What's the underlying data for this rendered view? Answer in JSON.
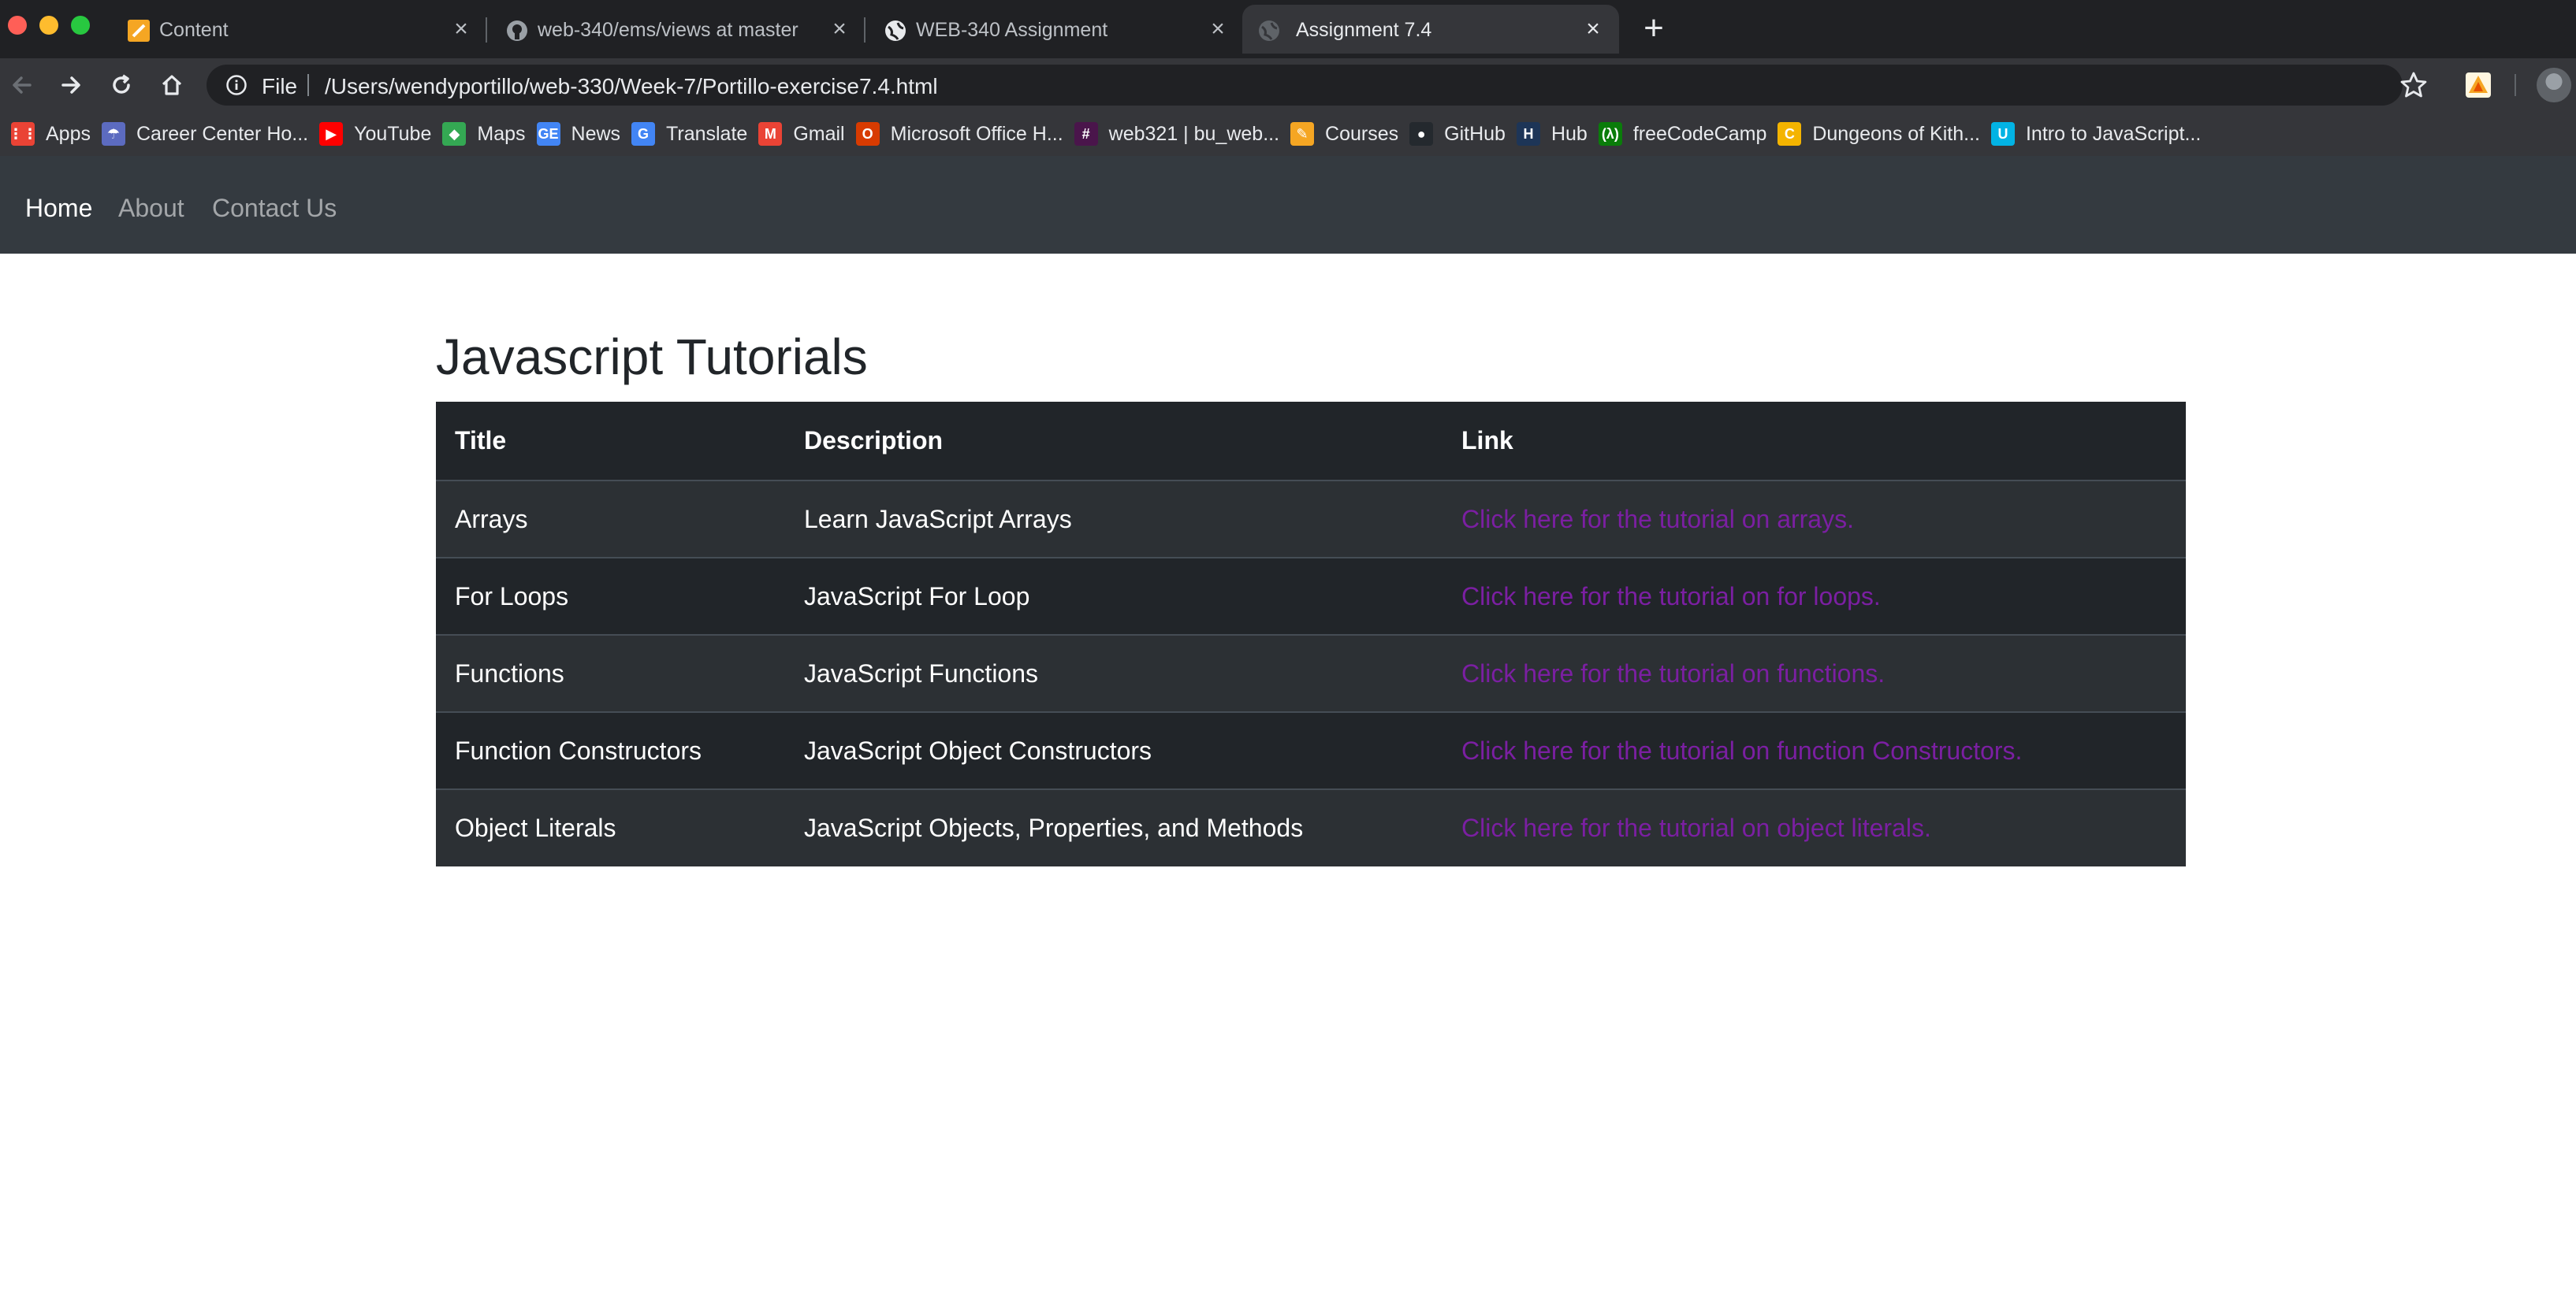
{
  "browser": {
    "tabs": [
      {
        "label": "Content",
        "icon": "notepad-icon",
        "active": false
      },
      {
        "label": "web-340/ems/views at master",
        "icon": "github-icon",
        "active": false
      },
      {
        "label": "WEB-340 Assignment",
        "icon": "globe-icon",
        "active": false
      },
      {
        "label": "Assignment 7.4",
        "icon": "globe-icon",
        "active": true
      }
    ],
    "address": {
      "scheme": "File",
      "url": "/Users/wendyportillo/web-330/Week-7/Portillo-exercise7.4.html"
    },
    "bookmarks": [
      {
        "label": "Apps",
        "icon": "apps-grid-icon",
        "color": "#ea4335"
      },
      {
        "label": "Career Center Ho...",
        "icon": "career-center-icon",
        "color": "#5c6bc0"
      },
      {
        "label": "YouTube",
        "icon": "youtube-icon",
        "color": "#ff0000"
      },
      {
        "label": "Maps",
        "icon": "maps-icon",
        "color": "#34a853"
      },
      {
        "label": "News",
        "icon": "google-news-icon",
        "color": "#4285f4"
      },
      {
        "label": "Translate",
        "icon": "google-translate-icon",
        "color": "#4285f4"
      },
      {
        "label": "Gmail",
        "icon": "gmail-icon",
        "color": "#ea4335"
      },
      {
        "label": "Microsoft Office H...",
        "icon": "office-icon",
        "color": "#d83b01"
      },
      {
        "label": "web321 | bu_web...",
        "icon": "slack-icon",
        "color": "#4a154b"
      },
      {
        "label": "Courses",
        "icon": "notepad-icon",
        "color": "#f5a623"
      },
      {
        "label": "GitHub",
        "icon": "github-icon",
        "color": "#24292e"
      },
      {
        "label": "Hub",
        "icon": "hub-icon",
        "color": "#1d3557"
      },
      {
        "label": "freeCodeCamp",
        "icon": "freecodecamp-icon",
        "color": "#0a7c0a"
      },
      {
        "label": "Dungeons of Kith...",
        "icon": "dungeons-icon",
        "color": "#f4b400"
      },
      {
        "label": "Intro to JavaScript...",
        "icon": "udacity-icon",
        "color": "#02b3e4"
      }
    ]
  },
  "site_nav": {
    "items": [
      {
        "label": "Home",
        "active": true
      },
      {
        "label": "About",
        "active": false
      },
      {
        "label": "Contact Us",
        "active": false
      }
    ]
  },
  "main": {
    "title": "Javascript Tutorials",
    "table": {
      "headers": [
        "Title",
        "Description",
        "Link"
      ],
      "rows": [
        {
          "title": "Arrays",
          "description": "Learn JavaScript Arrays",
          "link": "Click here for the tutorial on arrays."
        },
        {
          "title": "For Loops",
          "description": "JavaScript For Loop",
          "link": "Click here for the tutorial on for loops."
        },
        {
          "title": "Functions",
          "description": "JavaScript Functions",
          "link": "Click here for the tutorial on functions."
        },
        {
          "title": "Function Constructors",
          "description": "JavaScript Object Constructors",
          "link": "Click here for the tutorial on function Constructors."
        },
        {
          "title": "Object Literals",
          "description": "JavaScript Objects, Properties, and Methods",
          "link": "Click here for the tutorial on object literals."
        }
      ]
    }
  },
  "colors": {
    "navbar_bg": "#343a40",
    "table_dark": "#212529",
    "table_stripe": "#2c3034",
    "visited_link": "#7b1fa2"
  }
}
